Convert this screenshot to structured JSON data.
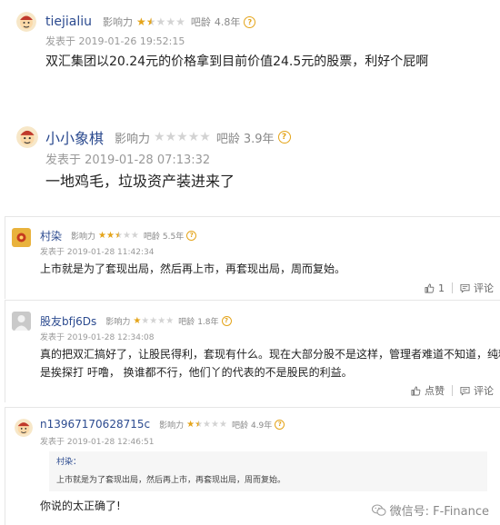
{
  "comments": [
    {
      "user": "tiejialiu",
      "influence_label": "影响力",
      "influence_stars": 1.5,
      "age_label": "吧龄",
      "age": "4.8年",
      "time": "发表于 2019-01-26 19:52:15",
      "text": "双汇集团以20.24元的价格拿到目前价值24.5元的股票，利好个屁啊"
    },
    {
      "user": "小小象棋",
      "influence_label": "影响力",
      "influence_stars": 0,
      "age_label": "吧龄",
      "age": "3.9年",
      "time": "发表于 2019-01-28 07:13:32",
      "text": "一地鸡毛，垃圾资产装进来了"
    },
    {
      "user": "村染",
      "influence_label": "影响力",
      "influence_stars": 2.5,
      "age_label": "吧龄",
      "age": "5.5年",
      "time": "发表于 2019-01-28 11:42:34",
      "text": "上市就是为了套现出局，然后再上市，再套现出局，周而复始。",
      "like_label": "1",
      "comment_label": "评论"
    },
    {
      "user": "股友bfj6Ds",
      "influence_label": "影响力",
      "influence_stars": 1,
      "age_label": "吧龄",
      "age": "1.8年",
      "time": "发表于 2019-01-28 12:34:08",
      "text_lines": [
        "真的把双汇搞好了，让股民得利，套现有什么。现在大部分股不是这样，管理者难道不知道，纯粹",
        "是挨探打 吁噜，  换谁都不行，他们丫的代表的不是股民的利益。"
      ],
      "like_label": "点赞",
      "comment_label": "评论"
    },
    {
      "user": "n13967170628715c",
      "influence_label": "影响力",
      "influence_stars": 1.5,
      "age_label": "吧龄",
      "age": "4.9年",
      "time": "发表于 2019-01-28 12:46:51",
      "quote_user": "村染：",
      "quote_text": "上市就是为了套现出局，然后再上市，再套现出局，周而复始。",
      "text": "你说的太正确了!"
    }
  ],
  "watermark": "微信号: F-Finance",
  "colors": {
    "star": "#e4a41a",
    "username": "#2b4a8f"
  }
}
